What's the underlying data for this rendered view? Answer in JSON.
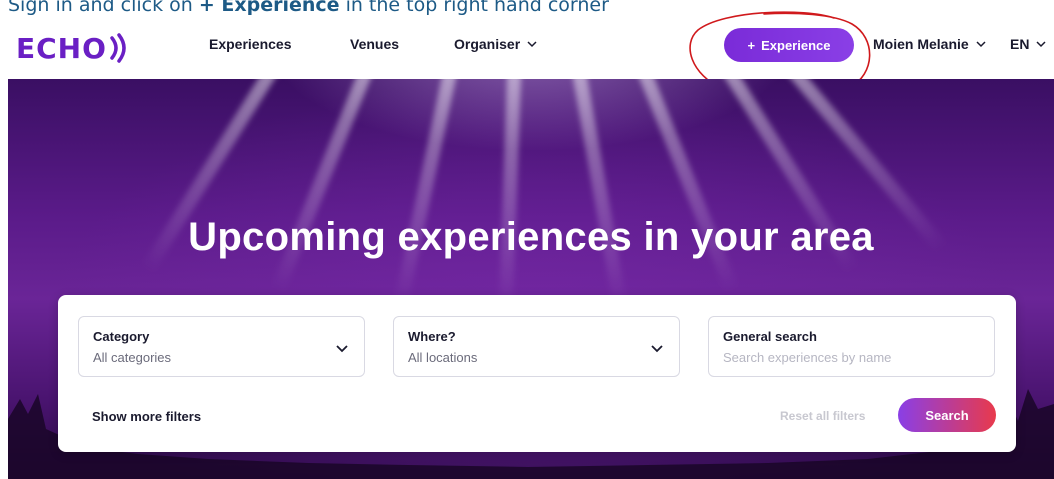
{
  "instruction": {
    "before": "Sign in and click on ",
    "bold": "+ Experience",
    "after": " in the top right hand corner"
  },
  "navbar": {
    "logo_text": "ECHO",
    "links": [
      {
        "label": "Experiences"
      },
      {
        "label": "Venues"
      },
      {
        "label": "Organiser"
      }
    ],
    "experience_button": {
      "icon": "+",
      "label": "Experience"
    },
    "user_name": "Moien Melanie",
    "language": "EN"
  },
  "hero": {
    "title": "Upcoming experiences in your area"
  },
  "filters": {
    "category": {
      "label": "Category",
      "value": "All categories"
    },
    "where": {
      "label": "Where?",
      "value": "All locations"
    },
    "general_search": {
      "label": "General search",
      "placeholder": "Search experiences by name"
    },
    "show_more": "Show more filters",
    "reset": "Reset all filters",
    "search_button": "Search"
  },
  "colors": {
    "brand": "#6a1fc4",
    "button_gradient_start": "#8a3fe6",
    "button_gradient_end": "#e83a4c",
    "instruction_text": "#1d5a86",
    "annotation_circle": "#d0191c"
  }
}
